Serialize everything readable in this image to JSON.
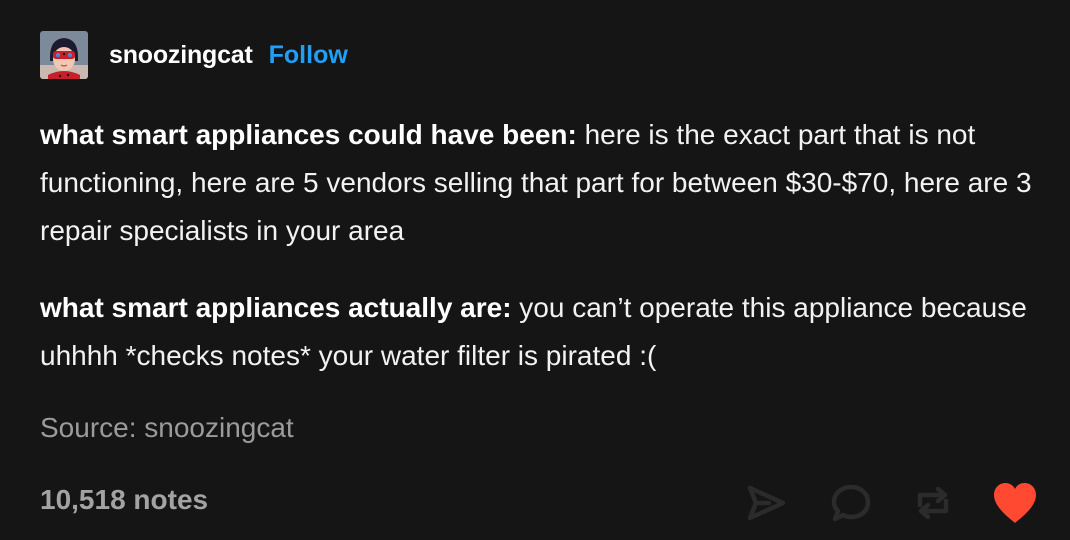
{
  "post": {
    "username": "snoozingcat",
    "follow_label": "Follow",
    "paragraphs": [
      {
        "bold": "what smart appliances could have been:",
        "text": " here is the exact part that is not functioning, here are 5 vendors selling that part for between $30-$70, here are 3 repair specialists in your area"
      },
      {
        "bold": "what smart appliances actually are:",
        "text": " you can’t operate this appliance because uhhhh *checks notes* your water filter is pirated :("
      }
    ],
    "source": "Source: snoozingcat",
    "notes": "10,518 notes"
  },
  "icons": {
    "avatar": "avatar-ladybug",
    "share": "share-icon",
    "reply": "reply-icon",
    "reblog": "reblog-icon",
    "like": "heart-icon"
  },
  "colors": {
    "background": "#151515",
    "accent": "#1f9ff5",
    "heart": "#ff4930",
    "muted_text": "#9b9b9b",
    "icon": "#2a2a2a"
  }
}
